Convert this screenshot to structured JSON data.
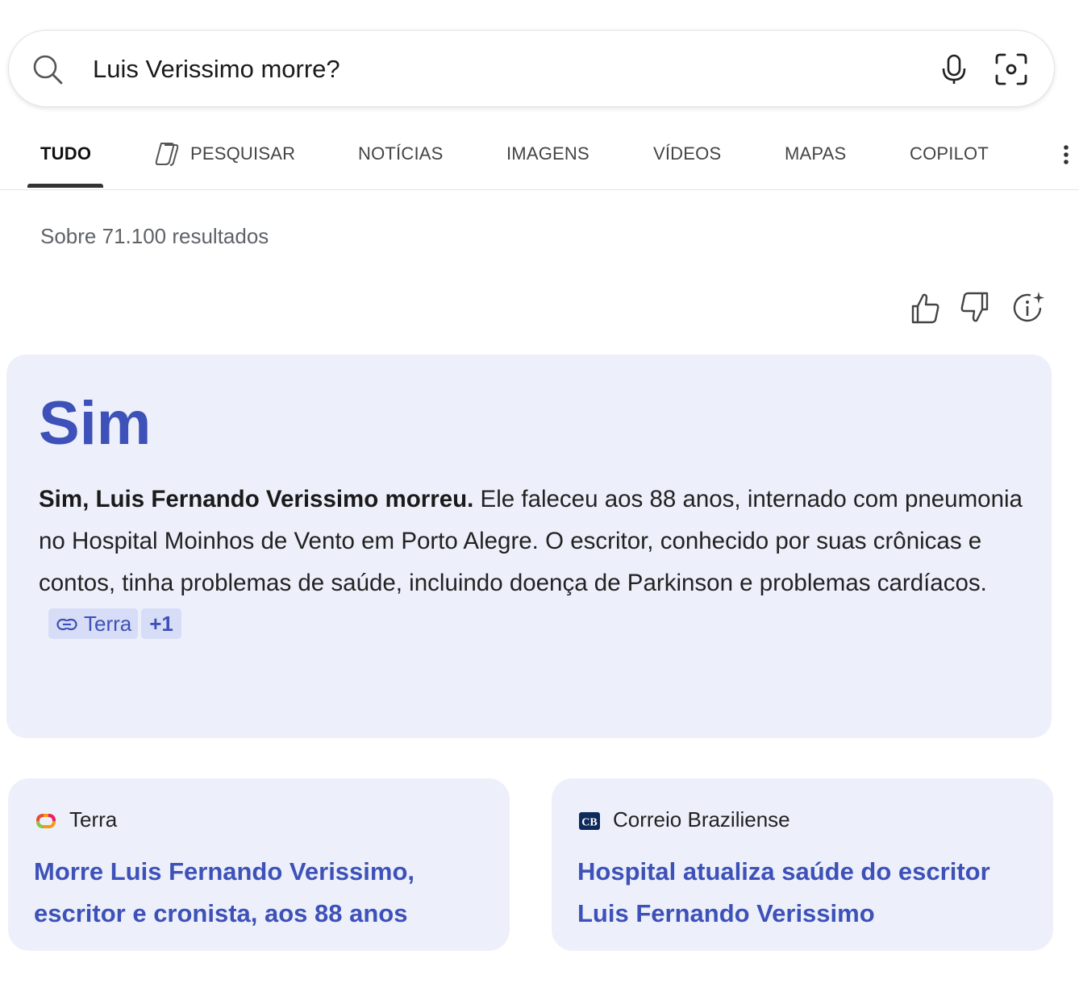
{
  "search": {
    "query": "Luis Verissimo morre?"
  },
  "tabs": [
    {
      "label": "TUDO",
      "active": true
    },
    {
      "label": "PESQUISAR",
      "active": false
    },
    {
      "label": "NOTÍCIAS",
      "active": false
    },
    {
      "label": "IMAGENS",
      "active": false
    },
    {
      "label": "VÍDEOS",
      "active": false
    },
    {
      "label": "MAPAS",
      "active": false
    },
    {
      "label": "COPILOT",
      "active": false
    }
  ],
  "results_count": "Sobre 71.100 resultados",
  "answer": {
    "title": "Sim",
    "bold_lead": "Sim, Luis Fernando Verissimo morreu.",
    "body": " Ele faleceu aos 88 anos, internado com pneumonia no Hospital Moinhos de Vento em Porto Alegre. O escritor, conhecido por suas crônicas e contos, tinha problemas de saúde, incluindo doença de Parkinson e problemas cardíacos.",
    "citation_label": "Terra",
    "citation_more": "+1"
  },
  "sources": [
    {
      "name": "Terra",
      "title": "Morre Luis Fernando Verissimo, escritor e cronista, aos 88 anos"
    },
    {
      "name": "Correio Braziliense",
      "title": "Hospital atualiza saúde do escritor Luis Fernando Verissimo",
      "logo_text": "CB"
    }
  ],
  "colors": {
    "accent": "#3d51b8",
    "card_bg": "#edf0fb",
    "cite_bg": "#d7ddf6"
  }
}
